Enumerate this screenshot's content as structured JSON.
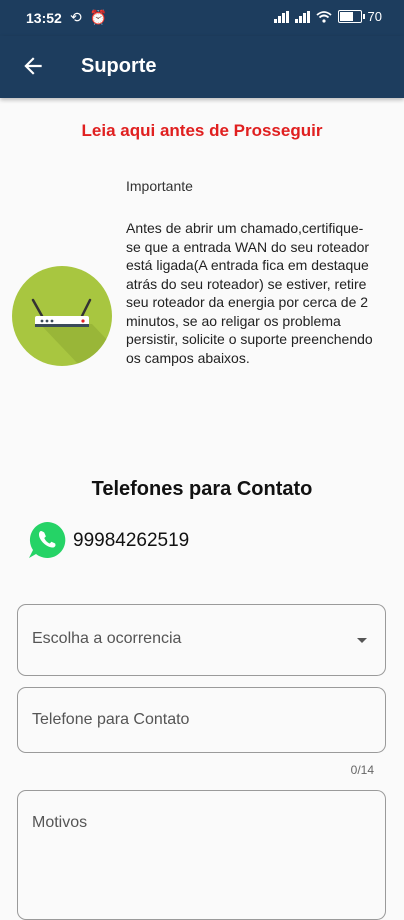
{
  "status_bar": {
    "time": "13:52",
    "battery_text": "70",
    "battery_level": 0.7,
    "icons": [
      "sync-icon",
      "alarm-icon",
      "signal-icon",
      "4g-signal-icon",
      "wifi-icon",
      "battery-icon"
    ]
  },
  "app_bar": {
    "title": "Suporte",
    "back_icon": "arrow-left-icon"
  },
  "warning": "Leia aqui antes de Prosseguir",
  "important": {
    "title": "Importante",
    "text": "Antes de abrir um chamado,certifique-se que a entrada WAN do seu roteador está ligada(A entrada fica em destaque atrás do seu roteador) se estiver, retire seu roteador da energia por cerca de 2 minutos, se ao religar os problema persistir, solicite o suporte preenchendo os campos abaixos.",
    "image_icon": "router-icon"
  },
  "contacts": {
    "title": "Telefones para Contato",
    "phone": "99984262519",
    "icon": "whatsapp-icon"
  },
  "form": {
    "occurrence_label": "Escolha a ocorrencia",
    "phone_label": "Telefone para Contato",
    "phone_counter": "0/14",
    "reasons_label": "Motivos"
  },
  "colors": {
    "app_bar": "#1d3d5e",
    "warning": "#e02020",
    "router_bg": "#a8c640",
    "whatsapp": "#25d366"
  }
}
